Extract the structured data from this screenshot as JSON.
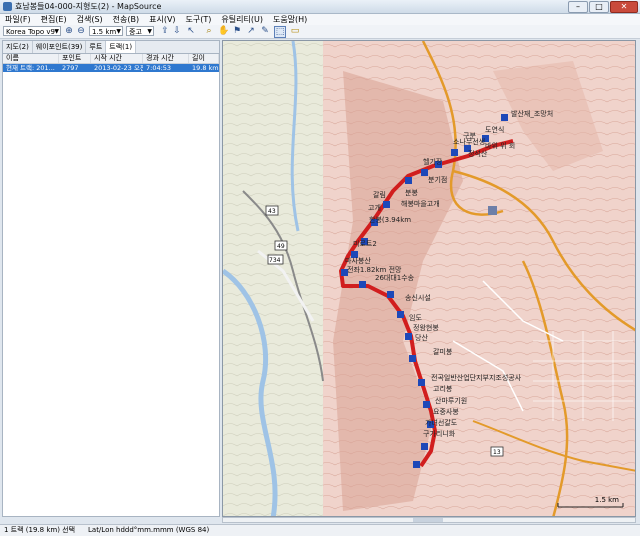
{
  "window": {
    "title": "효남봉들04-000-지형도(2) - MapSource",
    "minimize": "–",
    "maximize": "□",
    "close": "✕"
  },
  "menu": [
    "파일(F)",
    "편집(E)",
    "검색(S)",
    "전송(B)",
    "표시(V)",
    "도구(T)",
    "유틸리티(U)",
    "도움말(H)"
  ],
  "toolbar": {
    "map_product": "Korea Topo v9",
    "zoom_scale": "1.5 km",
    "detail": "중고",
    "icons": [
      "zoom-in-icon",
      "zoom-out-icon",
      "send-to-device-icon",
      "receive-from-device-icon",
      "select-tool-icon",
      "zoom-tool-icon",
      "pan-tool-icon",
      "waypoint-tool-icon",
      "route-tool-icon",
      "track-tool-icon",
      "distance-tool-icon"
    ]
  },
  "tabs": [
    "지도(2)",
    "웨이포인트(39)",
    "루트",
    "트랙(1)"
  ],
  "table": {
    "headers": [
      "이름",
      "포인트",
      "시작 시간",
      "경과 시간",
      "길이"
    ],
    "rows": [
      [
        "현재 트랙: 201...",
        "2797",
        "2013-02-23 오전 ...",
        "7:04:53",
        "19.8 km"
      ]
    ]
  },
  "map": {
    "scale_label": "1.5 km",
    "road_labels": [
      "43",
      "49",
      "734",
      "13"
    ],
    "waypoint_labels": [
      "발산재_조망처",
      "도연식",
      "구분",
      "소나무선생",
      "바위 위 회",
      "정석산",
      "남한산성",
      "헬기장",
      "분기점",
      "분봉",
      "해봉마을고개",
      "봉",
      "갈림",
      "고개",
      "한봉(3.94km",
      "미로트2",
      "마사봉산",
      "전좌1.82km 전망",
      "갈림길",
      "26대대1수송",
      "송신시설",
      "만봉",
      "전천석",
      "임도",
      "정왕현봉",
      "당산",
      "갈미봉",
      "전곡일반산업단지부지조성공사",
      "고리봉",
      "산마루기원",
      "계곡",
      "요중사봉",
      "범봉",
      "가녀선갈도",
      "구가리니화"
    ],
    "colors": {
      "relief_bg": "#f1d9d0",
      "track": "#d11e1e",
      "waypoint": "#1d48b8"
    }
  },
  "status": {
    "selection": "1 트랙 (19.8 km) 선택",
    "coord_format": "Lat/Lon hddd°mm.mmm (WGS 84)"
  }
}
